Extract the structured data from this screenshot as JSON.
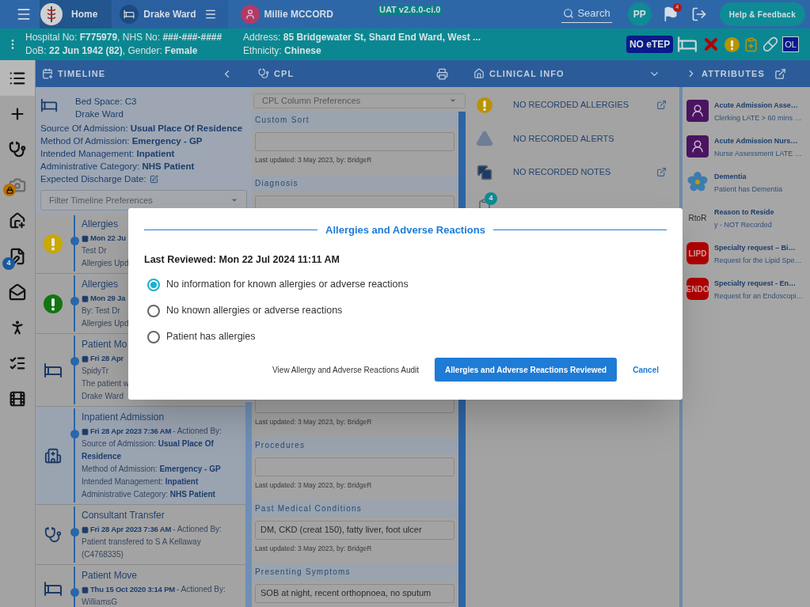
{
  "topbar": {
    "home": "Home",
    "ward": "Drake Ward",
    "patient": "Millie MCCORD",
    "env": "UAT v2.6.0-ci.0",
    "search": "Search",
    "avatar": "PP",
    "flag_badge": "4",
    "help": "Help & Feedback"
  },
  "patient_bar": {
    "left_lines": [
      "Hospital No: **F775979**, NHS No: **###-###-####**",
      "DoB: **22 Jun 1942 (82)**, Gender: **Female**"
    ],
    "right_lines": [
      "Address: **85 Bridgewater St, Shard End Ward, West ...**",
      "Ethnicity: **Chinese**"
    ],
    "badge": "NO eTEP",
    "tag": "OL"
  },
  "nav": [
    {
      "selected": true
    },
    {
      "selected": false
    },
    {
      "selected": false
    },
    {
      "selected": false,
      "locked": true
    },
    {
      "selected": false
    },
    {
      "selected": false,
      "badge": "4"
    },
    {
      "selected": false
    },
    {
      "selected": false
    },
    {
      "selected": false
    },
    {
      "selected": false
    }
  ],
  "column_headers": [
    {
      "label": "TIMELINE"
    },
    {
      "label": "CPL"
    },
    {
      "label": "CLINICAL INFO"
    },
    {
      "label": "ATTRIBUTES"
    }
  ],
  "timeline": {
    "bed_lines": [
      "Bed Space: C3",
      "Drake Ward"
    ],
    "lines": [
      "Source Of Admission: **Usual Place Of Residence**",
      "Method Of Admission: **Emergency - GP**",
      "Intended Management: **Inpatient**",
      "Administrative Category: **NHS Patient**"
    ],
    "discharge": "Expected Discharge Date:",
    "filter_placeholder": "Filter Timeline Preferences",
    "entries": [
      {
        "kind": "allergy",
        "color": "#c9a800",
        "highlighted": false,
        "title": "Allergies",
        "date": "Mon 22 Ju",
        "lines": [
          "Test Dr",
          "Allergies Upd"
        ]
      },
      {
        "kind": "allergy",
        "color": "#127512",
        "highlighted": false,
        "title": "Allergies",
        "date": "Mon 29 Ja",
        "lines": [
          "By: Test Dr",
          "Allergies Upd"
        ]
      },
      {
        "kind": "move",
        "highlighted": false,
        "title": "Patient Mo",
        "date": "Fri 28 Apr",
        "lines": [
          "SpidyTr",
          "The patient w",
          "Drake Ward"
        ]
      },
      {
        "kind": "admission",
        "highlighted": true,
        "title": "Inpatient Admission",
        "date": "Fri 28 Apr 2023 7:36 AM",
        "actioned": "- Actioned By:",
        "lines": [
          "Source of Admission: **Usual Place Of Residence**",
          "Method of Admission: **Emergency - GP**",
          "Intended Management: **Inpatient**",
          "Administrative Category: **NHS Patient**"
        ]
      },
      {
        "kind": "transfer",
        "highlighted": false,
        "title": "Consultant Transfer",
        "date": "Fri 28 Apr 2023 7:36 AM",
        "actioned": "- Actioned By:",
        "lines": [
          "Patient transfered to S A Kellaway (C4768335)"
        ]
      },
      {
        "kind": "move",
        "highlighted": false,
        "title": "Patient Move",
        "date": "Thu 15 Oct 2020 3:14 PM",
        "actioned": "- Actioned By:",
        "lines": [
          "WilliamsG"
        ]
      }
    ]
  },
  "cpl": {
    "preferences_placeholder": "CPL Column Preferences",
    "sections": [
      {
        "label": "Custom Sort",
        "updated": "Last updated: 3 May 2023, by: BridgeR"
      },
      {
        "label": "Diagnosis"
      },
      {
        "updated": "Last updated: 3 May 2023, by: BridgeR"
      },
      {
        "label": "Procedures",
        "updated": "Last updated: 3 May 2023, by: BridgeR"
      },
      {
        "label": "Past Medical Conditions",
        "value": "DM, CKD (creat 150), fatty liver, foot ulcer",
        "updated": "Last updated: 3 May 2023, by: BridgeR"
      },
      {
        "label": "Presenting Symptoms",
        "value": "SOB at night, recent orthopnoea, no sputum"
      }
    ]
  },
  "clinical_info": [
    {
      "kind": "allergies",
      "label": "NO RECORDED ALLERGIES",
      "link": true
    },
    {
      "kind": "alerts",
      "label": "NO RECORDED ALERTS",
      "link": false
    },
    {
      "kind": "notes",
      "label": "NO RECORDED NOTES",
      "link": true
    },
    {
      "kind": "forms",
      "badge": "4"
    }
  ],
  "attributes": [
    {
      "kind": "doctor",
      "color": "#4a1460",
      "title": "Acute Admission Asse…",
      "subtitle": "Clerking LATE > 60 mins …"
    },
    {
      "kind": "nurse",
      "color": "#4a1460",
      "title": "Acute Admission Nurs…",
      "subtitle": "Nurse Assessment LATE …"
    },
    {
      "kind": "flower",
      "title": "Dementia",
      "subtitle": "Patient has Dementia"
    },
    {
      "kind": "text",
      "tag": "RtoR",
      "title": "Reason to Reside",
      "subtitle": "y - NOT Recorded"
    },
    {
      "kind": "tag",
      "color": "#b00000",
      "tag": "LIPD",
      "title": "Specialty request – Bi…",
      "subtitle": "Request for the Lipid Spe…"
    },
    {
      "kind": "tag",
      "color": "#b00000",
      "tag": "ENDO",
      "title": "Specialty request - En…",
      "subtitle": "Request for an Endoscopi…"
    }
  ],
  "dialog": {
    "title": "Allergies and Adverse Reactions",
    "last_reviewed": "Last Reviewed: Mon 22 Jul 2024 11:11 AM",
    "options": [
      {
        "label": "No information for known allergies or adverse reactions",
        "selected": true
      },
      {
        "label": "No known allergies or adverse reactions",
        "selected": false
      },
      {
        "label": "Patient has allergies",
        "selected": false
      }
    ],
    "audit_link": "View Allergy and Adverse Reactions Audit",
    "confirm": "Allergies and Adverse Reactions Reviewed",
    "cancel": "Cancel"
  }
}
